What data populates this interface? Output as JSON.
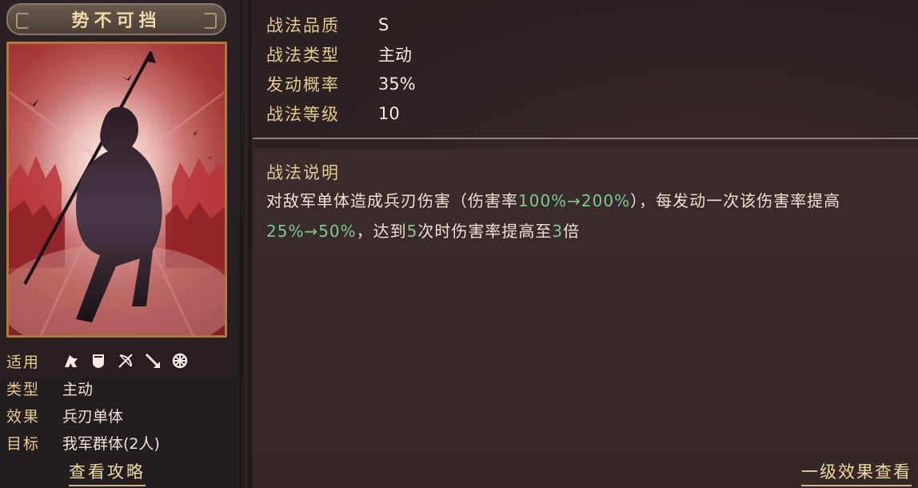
{
  "skill": {
    "name": "势不可挡"
  },
  "info": {
    "applicable_label": "适用",
    "applicable_icons": [
      "cavalry-icon",
      "shield-icon",
      "bow-icon",
      "spear-icon",
      "siege-wheel-icon"
    ],
    "type_label": "类型",
    "type_value": "主动",
    "effect_label": "效果",
    "effect_value": "兵刃单体",
    "target_label": "目标",
    "target_value": "我军群体(2人)",
    "strategy_link": "查看攻略"
  },
  "stats": {
    "quality_label": "战法品质",
    "quality_value": "S",
    "type_label": "战法类型",
    "type_value": "主动",
    "rate_label": "发动概率",
    "rate_value": "35%",
    "level_label": "战法等级",
    "level_value": "10"
  },
  "description": {
    "title": "战法说明",
    "p1": "对敌军单体造成兵刃伤害（伤害率",
    "g1": "100%→200%",
    "p2": "），每发动一次该伤害率提高",
    "g2": "25%→50%",
    "p3": "，达到",
    "g3": "5",
    "p4": "次时伤害率提高至",
    "g4": "3",
    "p5": "倍"
  },
  "effect_link": "一级效果查看",
  "colors": {
    "label_gold": "#e7c88f",
    "highlight_green": "#7fc98a",
    "card_red": "#a93b3b",
    "card_border": "#b07a3e"
  }
}
